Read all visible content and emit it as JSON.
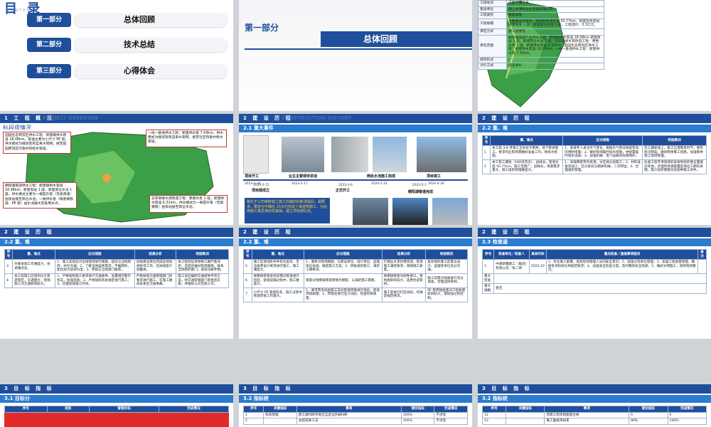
{
  "slide1": {
    "title": "目 录",
    "subtitle": "CONTENTS",
    "items": [
      {
        "tag": "第一部分",
        "label": "总体回顾"
      },
      {
        "tag": "第二部分",
        "label": "技术总结"
      },
      {
        "tag": "第三部分",
        "label": "心得体会"
      }
    ]
  },
  "slide2": {
    "chapter": "第一部分",
    "banner": "总体回顾"
  },
  "slide3": {
    "rows": [
      [
        "工程地点",
        "成都市蒲江县"
      ],
      [
        "建设单位",
        "蒲江县蒲禄企业管理有限公司"
      ],
      [
        "工程类别",
        "基础设施"
      ],
      [
        "工程规模",
        "主要建设内容为：新建和改造管道 50.77km，新建及改造加压泵站各 1 座，新建高位水池 1 座。工程造价：0.3亿元。"
      ],
      [
        "承包方式",
        "施工总承包"
      ],
      [
        "承包范围",
        "朝阳湖旅游产业供水工程：新建输供水管道 18.98km 新建泵站 1 座，新建高位水池 1 座；云岸翠峰水源改造工程：更换水泵 1 组，新建供水管道 6.31km；田园生态商贸区供水工程：新建供水管道 18.06km；一块一基地供水工程：新建供水管 7.43km。"
      ],
      [
        "结构形式",
        "/"
      ],
      [
        "计价方式",
        "固定单价"
      ]
    ]
  },
  "slide4": {
    "header": "1 工 程 概 况",
    "ghost": "PROJECT OVERVIEW",
    "label": "标段成情况",
    "callouts": [
      "田园生态商贸区供水工程：新建输供水管道 18.06km，管道主要为小尺寸 PE 管，供水模式为接驳现有自来水管网，接至田园商贸区内各村的给水管道。",
      "一块一基地供水工程：新建供水管 7.43km，供水模式为接驳现有自来水管网，接至社区和各村给水管道。",
      "朝阳湖旅游供水工程：新建输供水管道 18.98km，新建泵站 1 座，新建高位水池 1 座，供水模式主要为一根提升管（无级调速）由泵站接至高位水池，一根供水管（球墨铸铁管、PE 管）由水池输水至各用水点。",
      "云岸翠峰水源改造工程：更换水泵 1 组，新建供水管道 6.31km，供水模式为一根提升管（无缝钢管）由泵站接至高位水池。"
    ]
  },
  "slide5": {
    "header": "2 建 设 历 程",
    "ghost": "CONSTRUCTION HISTORY",
    "sub": "2.1 重大事件",
    "events": [
      {
        "label": "项目开工",
        "date": "2023-1-31"
      },
      {
        "label": "项目部成立",
        "date": "2023-2-15"
      },
      {
        "label": "业主主要领导讲话",
        "date": "2023-2-17"
      },
      {
        "label": "正式开工",
        "date": "2023-3-6"
      },
      {
        "label": "两处水池施工完成",
        "date": "2024-1-31"
      },
      {
        "label": "朝阳湖管道完成",
        "date": "2023-5-1"
      },
      {
        "label": "项目竣工",
        "date": "2024-4-30"
      }
    ],
    "note": "绝在于公司维修其之施工前面的的新流程后，最要求，要进在中确后 15次内完成了渠道管施工，为后续施工奠定良好的基础，建立项目部队伍。"
  },
  "slide6": {
    "header": "2 建 设 历 程",
    "sub": "2.2 重、难",
    "cols": [
      "序号",
      "重、难点",
      "应对措施",
      "经验教训"
    ],
    "rows": [
      [
        "1",
        "本工程 3-8 月施工正好处于雨季，地下管道施工，要求作业现场需做好准备工作，防排水措施。",
        "1、安排专人关注天气变化，根据天气情况采取有效的预防措施；2、做好现场临时排水措施，并配置临时排水设备；3、加强机械、电气设备的防雨保护。",
        "在工期安排上，施工正值雨季时节，要有防汛预案，做好雨季施工措施，加强雨季施工现场管理。"
      ],
      [
        "2",
        "本工程工期短（180日历天），战线长，管道长度 50.77km，施工范围广，战线长，资源需求量大，施工组织管理难度大。",
        "1、采取两家劳务资源，分区域分段施工；2、材料准备及加工，区分各段与相关机械，二次转运；3、合理组织管理。",
        "此类工程专项资源的安排和组织要全面提前考虑，合理的资源配置是保证工期的关键，施工组织需要创造各种施工条件。"
      ]
    ]
  },
  "slide7": {
    "header": "2 建 设 历 程",
    "sub": "2.2 重、难",
    "cols": [
      "序号",
      "重、难点",
      "应对措施",
      "结果分析",
      "经验教训"
    ],
    "rows": [
      [
        "3",
        "外部协调工作难度大，协调难点多。",
        "1、施工前提前对全线现场进行踏勘，提前与当地政府、村社沟通；2、了解当地居民需求，不推卸的，配合加大协调力度；3、积极与当地部门联系。",
        "协助建设单位完成征地协调各项工作，在按进度计划推进。",
        "本工程因征地导致工期严重滞后，应提前做好现场踏勘，联系当地政府部门，提前化解矛盾。"
      ],
      [
        "4",
        "本工程施工区域均位于旅游景区，交通量大，管线施工对交通影响较大。",
        "1、严格按照施工要求进行交通疏导，设置相应警示标志，加强巡视；2、严格按照有关规定进行施工；3、合理安排施工时间。",
        "严格按照交通管理部门的要求进行施工，在施工期间未发生交通事故。",
        "施工前应编制交通疏导专项方案，经交通管理部门审批后实施，并做好公众告知工作。"
      ]
    ]
  },
  "slide8": {
    "sub": "2.2 重、难",
    "cols": [
      "序号",
      "重、难点",
      "应对措施",
      "结果分析",
      "经验教训"
    ],
    "rows": [
      [
        "5",
        "施工区域地形条件较为复杂，无法按原设计要求进行施工，施工难度大。",
        "1、重新对现场踏勘，与建设单位、设计单位、监理单位协调，确定施工方案；2、积极组织施工，满足工期要求。",
        "打钢丝水泥封堵完成，管道施工满足要求，保障施工质量。",
        "复杂地形施工前需与设计、监理等单位充分沟通。"
      ],
      [
        "6",
        "球墨铸铁管安装前需对管道进行检验，管道运输过程中，施工难度大。",
        "将部分球墨铸铁管转换为钢管，以满足施工需要。",
        "球墨铸铁管为刚性接口，受地质影响较大，选用合适管材。",
        "施工前需对地质进行充分调查，合理选择管材。"
      ],
      [
        "7",
        "小尺寸 PE 管道较多，施工过程中管道焊接工作量大。",
        "1、要求劳务班组施工前对管道焊接进行培训，提高焊接质量；2、焊接后进行压力试验，检查焊接质量。",
        "施工后进行打压试验，均满足规范要求。",
        "PE 管焊接质量对工程质量影响较大，需加强过程控制。"
      ]
    ]
  },
  "slide9": {
    "sub": "2.3 检查通",
    "cols": [
      "序号",
      "检查单位／检查人",
      "具体时间",
      "重点检查／通报事项描述",
      "备注"
    ],
    "rows": [
      [
        "1",
        "中建新疆建工（集团）有限公司／张二炳",
        "2023.10",
        "1、优化施工部署，提高现场管理人员的安全意识；2、加强分包单位管理；3、加强工程质量管理，确保各项指标达到规范要求；4、加强安全检查力度，及时整改安全隐患；5、做好文明施工，保持现场整洁。",
        ""
      ]
    ],
    "label": "重大检查",
    "label2": "重大通报",
    "val2": "暂无"
  },
  "slide10": {
    "header": "3 目 标 指 标",
    "sub": "3.1 目标分",
    "cols": [
      "序号",
      "类别",
      "管理目标",
      "完成情况"
    ]
  },
  "slide11": {
    "header": "3 目 标 指 标",
    "sub": "3.2 指标统",
    "cols": [
      "序号",
      "关键指标",
      "事项",
      "理论指标",
      "完成情况"
    ],
    "rows": [
      [
        "1",
        "科技管理",
        "建工级科研项目应当适当开展科研",
        "100%",
        "不涉及"
      ],
      [
        "2",
        "",
        "总结成果工法",
        "100%",
        "不涉及"
      ]
    ]
  },
  "slide12": {
    "header": "3 目 标 指 标",
    "sub": "3.2 指标统",
    "cols": [
      "序号",
      "关键指标",
      "事项",
      "理论指标",
      "完成情况"
    ],
    "rows": [
      [
        "12",
        "",
        "领建工程项目质量合格",
        "0",
        "0"
      ],
      [
        "13",
        "",
        "施工图纸审核率",
        "80%",
        "100%"
      ]
    ]
  }
}
